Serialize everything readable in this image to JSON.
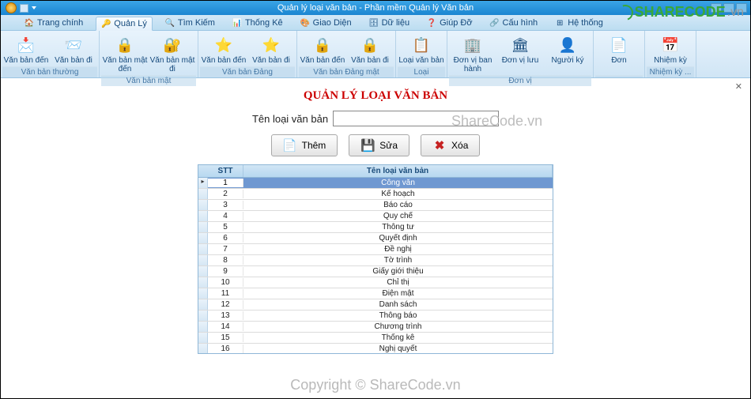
{
  "window": {
    "title": "Quản lý loại văn bản - Phần mềm Quản lý Văn bản"
  },
  "tabs": [
    {
      "label": "Trang chính",
      "icon": "🏠"
    },
    {
      "label": "Quản Lý",
      "icon": "🔑"
    },
    {
      "label": "Tìm Kiếm",
      "icon": "🔍"
    },
    {
      "label": "Thống Kê",
      "icon": "📊"
    },
    {
      "label": "Giao Diện",
      "icon": "🎨"
    },
    {
      "label": "Dữ liệu",
      "icon": "🗄"
    },
    {
      "label": "Giúp Đỡ",
      "icon": "❓"
    },
    {
      "label": "Cấu hình",
      "icon": "🔗"
    },
    {
      "label": "Hệ thống",
      "icon": "⊞"
    }
  ],
  "ribbon": {
    "groups": [
      {
        "label": "Văn bản thường",
        "buttons": [
          {
            "label": "Văn bản đến",
            "icon": "📩"
          },
          {
            "label": "Văn bản đi",
            "icon": "📨"
          }
        ]
      },
      {
        "label": "Văn bản mật",
        "buttons": [
          {
            "label": "Văn bản mật đến",
            "icon": "🔒"
          },
          {
            "label": "Văn bản mật đi",
            "icon": "🔐"
          }
        ]
      },
      {
        "label": "Văn bản Đảng",
        "buttons": [
          {
            "label": "Văn bản đến",
            "icon": "⭐"
          },
          {
            "label": "Văn bản đi",
            "icon": "⭐"
          }
        ]
      },
      {
        "label": "Văn bản Đảng mật",
        "buttons": [
          {
            "label": "Văn bản đến",
            "icon": "🔒"
          },
          {
            "label": "Văn bản đi",
            "icon": "🔒"
          }
        ]
      },
      {
        "label": "Loại",
        "buttons": [
          {
            "label": "Loại văn bản",
            "icon": "📋"
          }
        ]
      },
      {
        "label": "Đơn vị",
        "buttons": [
          {
            "label": "Đơn vị ban hành",
            "icon": "🏢"
          },
          {
            "label": "Đơn vị lưu",
            "icon": "🏛"
          },
          {
            "label": "Người ký",
            "icon": "👤"
          }
        ]
      },
      {
        "label": "",
        "buttons": [
          {
            "label": "Đơn",
            "icon": "📄"
          }
        ]
      },
      {
        "label": "Nhiệm kỳ ...",
        "buttons": [
          {
            "label": "Nhiệm kỳ",
            "icon": "📅"
          }
        ]
      }
    ]
  },
  "page": {
    "heading": "QUẢN LÝ LOẠI VĂN BẢN",
    "field_label": "Tên loại văn bản",
    "field_value": "",
    "btn_add": "Thêm",
    "btn_edit": "Sửa",
    "btn_delete": "Xóa"
  },
  "grid": {
    "col_stt": "STT",
    "col_name": "Tên loại văn bản",
    "rows": [
      {
        "stt": 1,
        "name": "Công văn",
        "selected": true
      },
      {
        "stt": 2,
        "name": "Kế hoạch"
      },
      {
        "stt": 3,
        "name": "Báo cáo"
      },
      {
        "stt": 4,
        "name": "Quy chế"
      },
      {
        "stt": 5,
        "name": "Thông tư"
      },
      {
        "stt": 6,
        "name": "Quyết định"
      },
      {
        "stt": 7,
        "name": "Đề nghị"
      },
      {
        "stt": 8,
        "name": "Tờ trình"
      },
      {
        "stt": 9,
        "name": "Giấy giới thiệu"
      },
      {
        "stt": 10,
        "name": "Chỉ thị"
      },
      {
        "stt": 11,
        "name": "Điện mật"
      },
      {
        "stt": 12,
        "name": "Danh sách"
      },
      {
        "stt": 13,
        "name": "Thông báo"
      },
      {
        "stt": 14,
        "name": "Chương trình"
      },
      {
        "stt": 15,
        "name": "Thống kê"
      },
      {
        "stt": 16,
        "name": "Nghị quyết"
      }
    ]
  },
  "watermark": {
    "brand": "SHARECODE",
    "brand_suffix": ".vn",
    "mid": "ShareCode.vn",
    "bottom": "Copyright © ShareCode.vn"
  }
}
